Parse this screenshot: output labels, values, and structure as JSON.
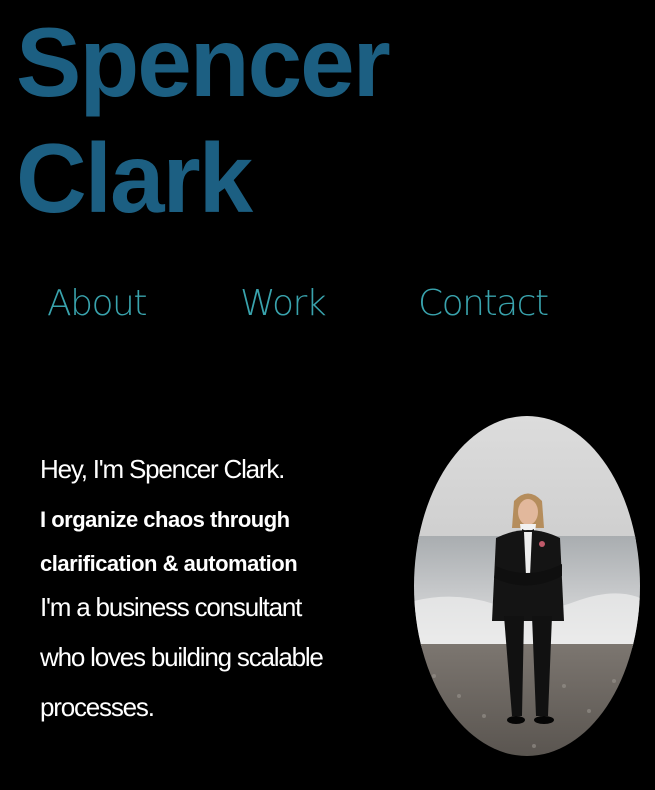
{
  "header": {
    "title_line1": "Spencer",
    "title_line2": "Clark",
    "title_color": "#1c5f82"
  },
  "nav": {
    "color": "#39a3ad",
    "items": [
      {
        "label": "About"
      },
      {
        "label": "Work"
      },
      {
        "label": "Contact"
      }
    ]
  },
  "intro": {
    "greeting": "Hey, I'm Spencer Clark.",
    "tagline_line1": "I organize chaos through",
    "tagline_line2": "clarification & automation",
    "desc_line1": "I'm a business consultant",
    "desc_line2": "who loves building scalable",
    "desc_line3": "processes."
  },
  "photo": {
    "icon": "portrait-photo"
  }
}
